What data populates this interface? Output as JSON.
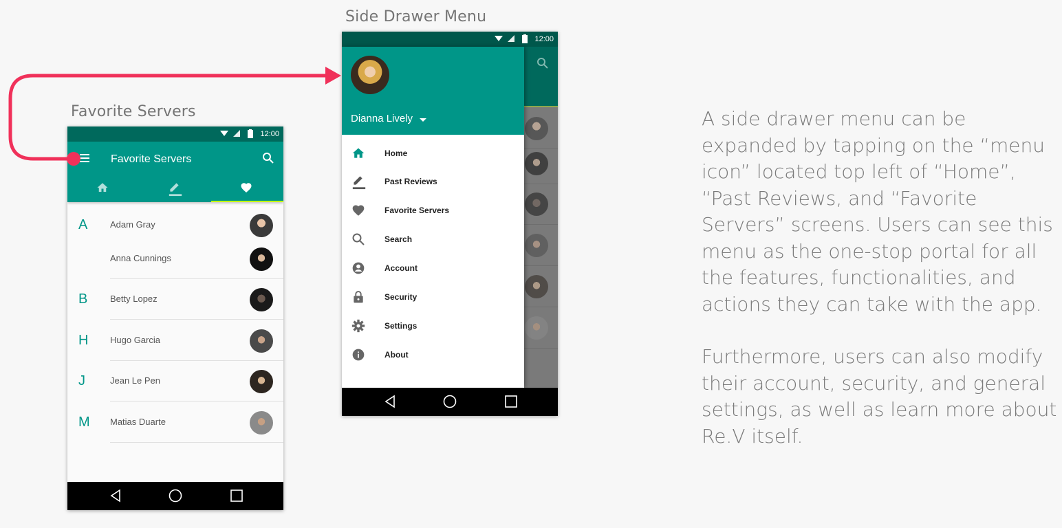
{
  "captions": {
    "drawer": "Side Drawer Menu",
    "favorites": "Favorite Servers"
  },
  "status_time": "12:00",
  "favorites_screen": {
    "title": "Favorite Servers",
    "tabs": [
      {
        "icon": "home-icon",
        "active": false
      },
      {
        "icon": "edit-icon",
        "active": false
      },
      {
        "icon": "heart-icon",
        "active": true
      }
    ],
    "entries": [
      {
        "letter": "A",
        "name": "Adam Gray"
      },
      {
        "letter": "",
        "name": "Anna Cunnings"
      },
      {
        "letter": "B",
        "name": "Betty Lopez"
      },
      {
        "letter": "H",
        "name": "Hugo Garcia"
      },
      {
        "letter": "J",
        "name": "Jean Le Pen"
      },
      {
        "letter": "M",
        "name": "Matias Duarte"
      }
    ]
  },
  "drawer_screen": {
    "user_name": "Dianna Lively",
    "items": [
      {
        "label": "Home",
        "icon": "home-icon"
      },
      {
        "label": "Past Reviews",
        "icon": "edit-icon"
      },
      {
        "label": "Favorite Servers",
        "icon": "heart-icon"
      },
      {
        "label": "Search",
        "icon": "search-icon"
      },
      {
        "label": "Account",
        "icon": "account-icon"
      },
      {
        "label": "Security",
        "icon": "lock-icon"
      },
      {
        "label": "Settings",
        "icon": "gear-icon"
      },
      {
        "label": "About",
        "icon": "info-icon"
      }
    ]
  },
  "description": {
    "paragraph1": "A side drawer menu can be expanded by tapping on the “menu icon” located top left of “Home”, “Past Reviews, and “Favorite Servers” screens. Users can see this menu as the one-stop portal for all the features, functionalities, and actions they can take with the app.",
    "paragraph2": "Furthermore, users can also modify their account, security, and general settings, as well as learn more about Re.V itself."
  },
  "colors": {
    "primary": "#009688",
    "primary_dark": "#00695c",
    "accent_indicator": "#c6ff00",
    "arrow": "#f0315a"
  }
}
